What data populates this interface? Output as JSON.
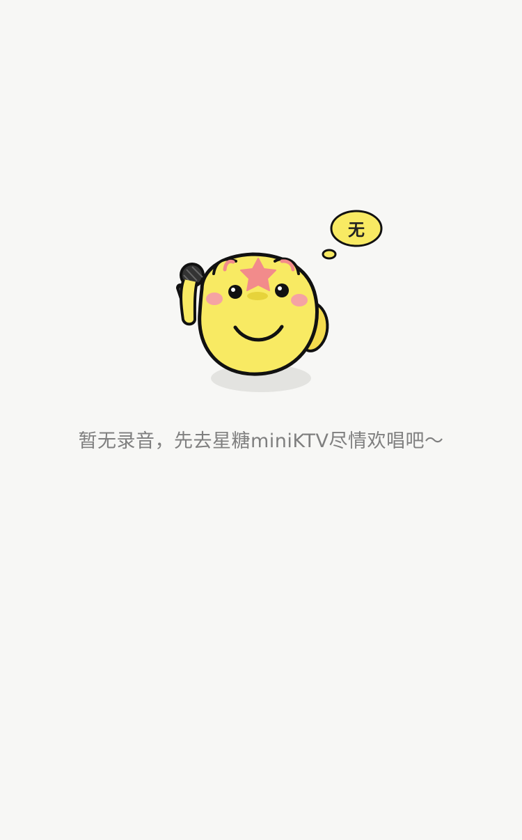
{
  "empty_state": {
    "thought_bubble_text": "无",
    "message": "暂无录音，先去星糖miniKTV尽情欢唱吧～"
  },
  "icons": {
    "mascot": "singing-mascot-icon",
    "microphone": "microphone-icon",
    "star": "star-icon"
  },
  "colors": {
    "background": "#f7f7f5",
    "text": "#7f7f7f",
    "mascot_body": "#f8ea63",
    "mascot_star": "#f28b8b",
    "mascot_cheeks": "#f5a3a3"
  }
}
